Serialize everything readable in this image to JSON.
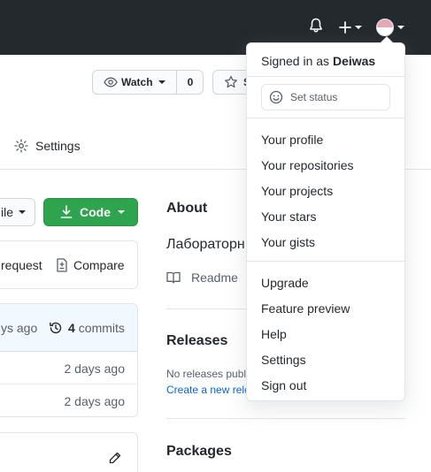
{
  "topbar": {
    "icons": [
      "bell-icon",
      "plus-icon",
      "avatar"
    ]
  },
  "repo_header": {
    "watch_label": "Watch",
    "watch_count": "0",
    "star_label": "S"
  },
  "tabs": {
    "settings_label": "Settings"
  },
  "code_area": {
    "branch_label": "ile",
    "code_button_label": "Code",
    "pull_request_label": "request",
    "compare_label": "Compare",
    "latest_commit_time": "ys ago",
    "commits_count": "4",
    "commits_label": "commits",
    "files": [
      {
        "time": "2 days ago"
      },
      {
        "time": "2 days ago"
      }
    ]
  },
  "sidebar": {
    "about_title": "About",
    "description": "Лабораторн",
    "readme_label": "Readme",
    "releases_title": "Releases",
    "no_releases_text": "No releases publi",
    "create_release_link": "Create a new rele",
    "packages_title": "Packages"
  },
  "user_menu": {
    "signed_in_prefix": "Signed in as ",
    "username": "Deiwas",
    "set_status_label": "Set status",
    "items_group1": [
      "Your profile",
      "Your repositories",
      "Your projects",
      "Your stars",
      "Your gists"
    ],
    "items_group2": [
      "Upgrade",
      "Feature preview",
      "Help",
      "Settings",
      "Sign out"
    ]
  },
  "colors": {
    "topbar_bg": "#24292e",
    "primary_green": "#2ea44f",
    "link_blue": "#0366d6",
    "border": "#e1e4e8",
    "commit_bar_bg": "#f1f8ff"
  }
}
